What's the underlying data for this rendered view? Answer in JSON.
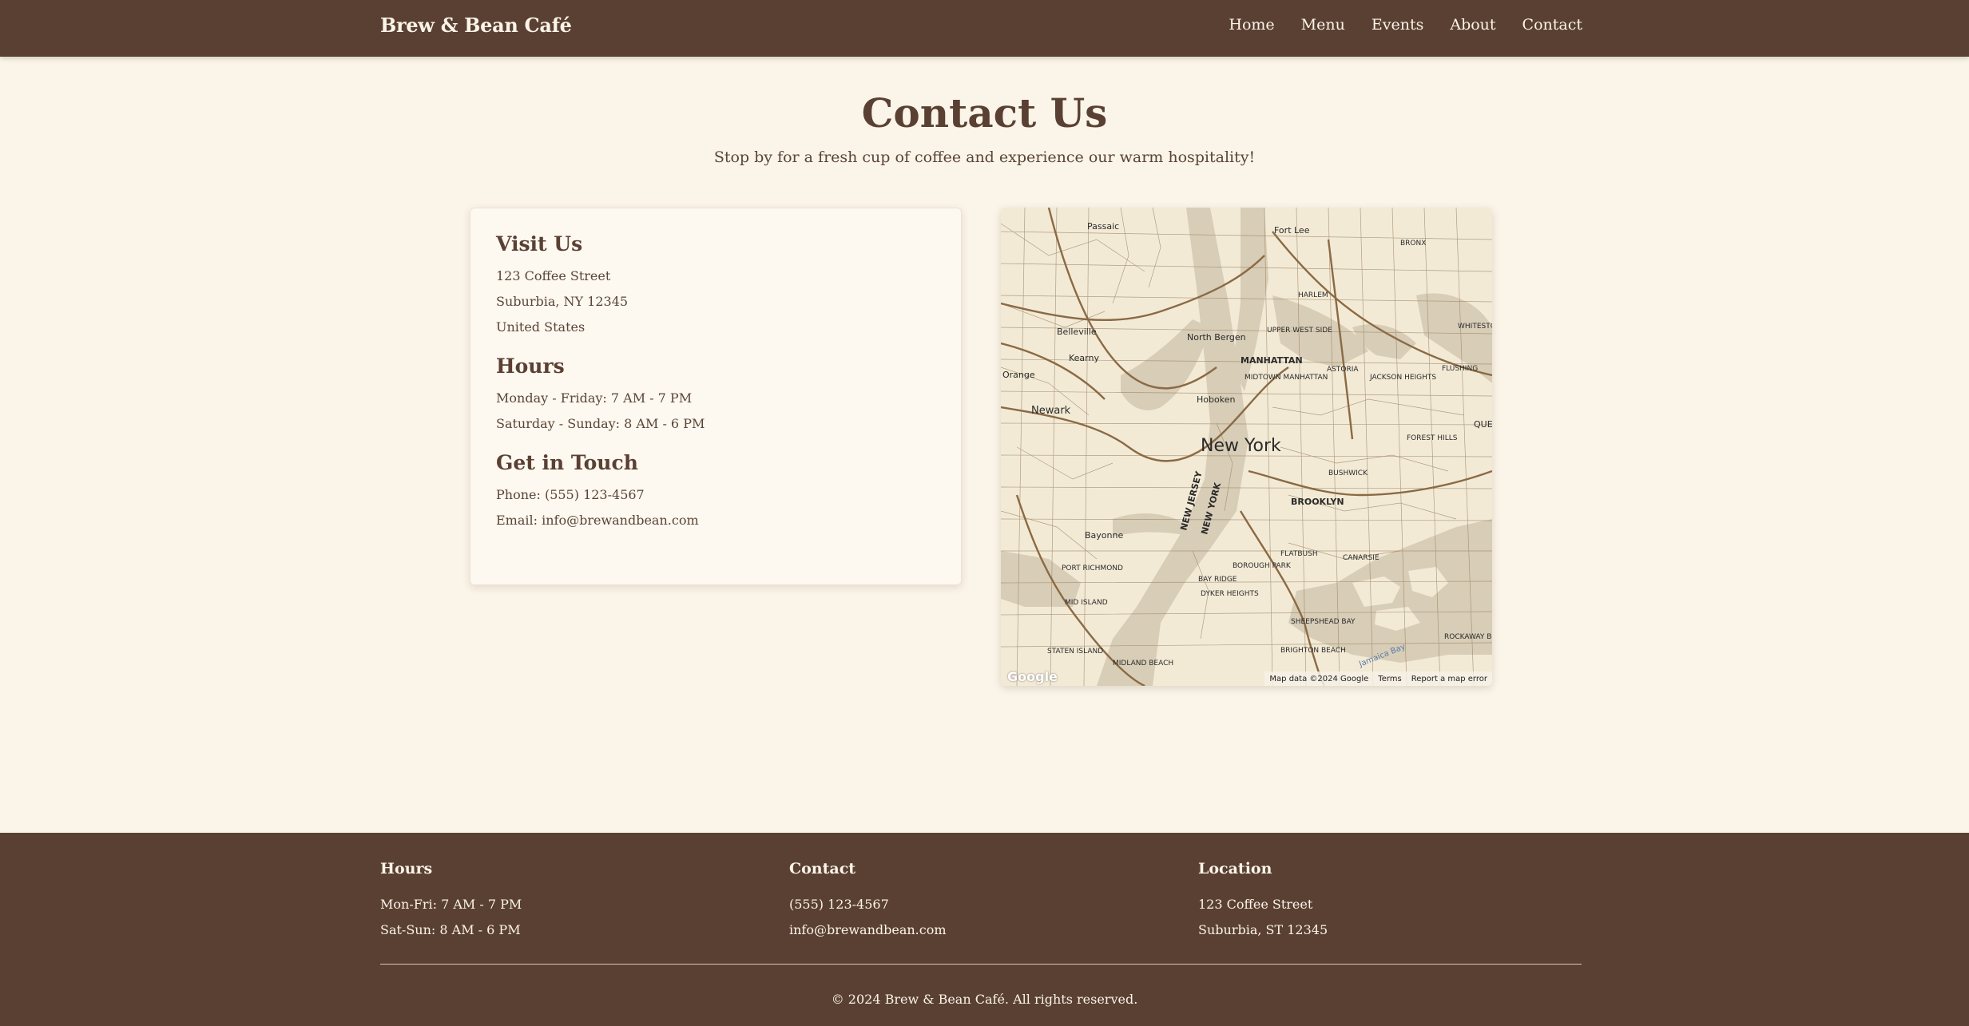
{
  "nav": {
    "brand": "Brew & Bean Café",
    "links": [
      "Home",
      "Menu",
      "Events",
      "About",
      "Contact"
    ]
  },
  "hero": {
    "title": "Contact Us",
    "subtitle": "Stop by for a fresh cup of coffee and experience our warm hospitality!"
  },
  "info": {
    "visit": {
      "heading": "Visit Us",
      "lines": [
        "123 Coffee Street",
        "Suburbia, NY 12345",
        "United States"
      ]
    },
    "hours": {
      "heading": "Hours",
      "lines": [
        "Monday - Friday: 7 AM - 7 PM",
        "Saturday - Sunday: 8 AM - 6 PM"
      ]
    },
    "touch": {
      "heading": "Get in Touch",
      "phone": "Phone: (555) 123-4567",
      "email": "Email: info@brewandbean.com"
    }
  },
  "map": {
    "logo": "Google",
    "attribution": "Map data ©2024 Google",
    "terms": "Terms",
    "report": "Report a map error",
    "labels": {
      "new_york": "New York",
      "newark": "Newark",
      "manhattan": "MANHATTAN",
      "brooklyn": "BROOKLYN",
      "hoboken": "Hoboken",
      "bayonne": "Bayonne",
      "belleville": "Belleville",
      "kearny": "Kearny",
      "north_bergen": "North Bergen",
      "passaic": "Passaic",
      "fort_lee": "Fort Lee",
      "harlem": "HARLEM",
      "bronx": "BRONX",
      "astoria": "ASTORIA",
      "flushing": "FLUSHING",
      "jackson_heights": "JACKSON HEIGHTS",
      "forest_hills": "FOREST HILLS",
      "bushwick": "BUSHWICK",
      "flatbush": "FLATBUSH",
      "canarsie": "CANARSIE",
      "bay_ridge": "BAY RIDGE",
      "borough_park": "BOROUGH PARK",
      "dyker_heights": "DYKER HEIGHTS",
      "sheepshead_bay": "SHEEPSHEAD BAY",
      "brighton_beach": "BRIGHTON BEACH",
      "rockaway_beach": "ROCKAWAY BEACH",
      "staten_island": "STATEN ISLAND",
      "midland_beach": "MIDLAND BEACH",
      "port_richmond": "PORT RICHMOND",
      "mid_island": "MID ISLAND",
      "upper_west_side": "UPPER WEST SIDE",
      "midtown_manhattan": "MIDTOWN MANHATTAN",
      "new_jersey": "NEW JERSEY",
      "new_york_state": "NEW YORK",
      "orange": "Orange",
      "whitestone": "WHITESTO",
      "jamaica_bay": "Jamaica Bay",
      "que": "QUE"
    }
  },
  "footer": {
    "hours": {
      "heading": "Hours",
      "lines": [
        "Mon-Fri: 7 AM - 7 PM",
        "Sat-Sun: 8 AM - 6 PM"
      ]
    },
    "contact": {
      "heading": "Contact",
      "lines": [
        "(555) 123-4567",
        "info@brewandbean.com"
      ]
    },
    "location": {
      "heading": "Location",
      "lines": [
        "123 Coffee Street",
        "Suburbia, ST 12345"
      ]
    },
    "copyright": "© 2024 Brew & Bean Café. All rights reserved."
  }
}
